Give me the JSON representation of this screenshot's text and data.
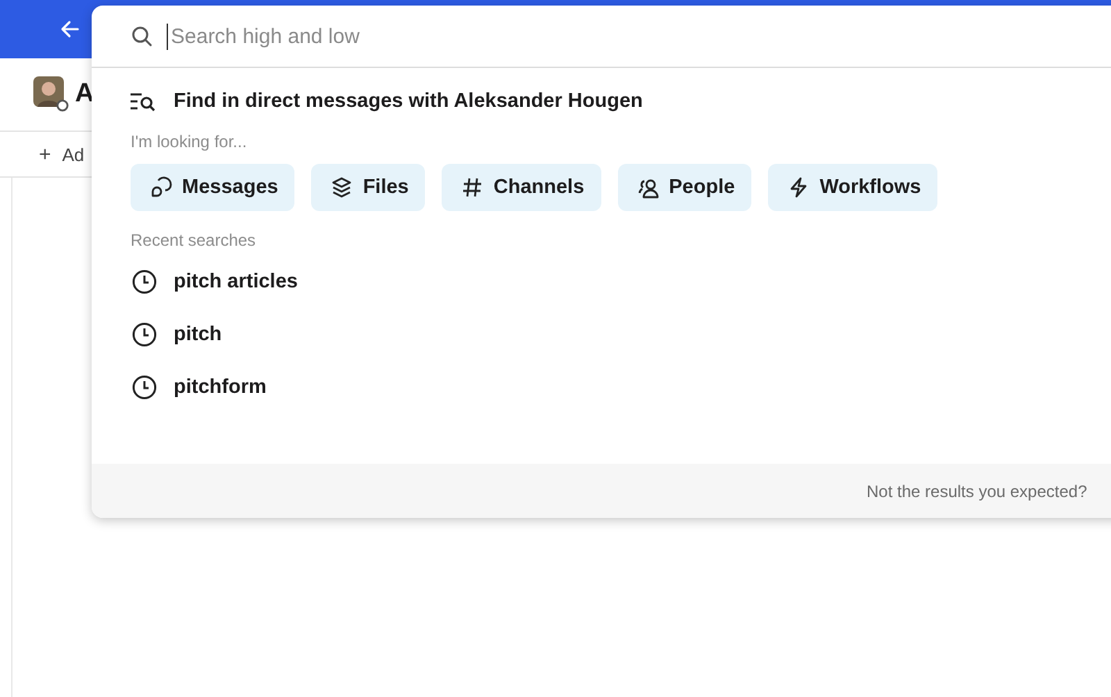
{
  "header": {
    "name": "A"
  },
  "add_row": {
    "icon": "+",
    "label": "Ad"
  },
  "search": {
    "placeholder": "Search high and low"
  },
  "scope": {
    "label": "Find in direct messages with Aleksander Hougen"
  },
  "filters_heading": "I'm looking for...",
  "filters": [
    {
      "kind": "messages",
      "label": "Messages"
    },
    {
      "kind": "files",
      "label": "Files"
    },
    {
      "kind": "channels",
      "label": "Channels"
    },
    {
      "kind": "people",
      "label": "People"
    },
    {
      "kind": "workflows",
      "label": "Workflows"
    }
  ],
  "recent_heading": "Recent searches",
  "recent": [
    {
      "label": "pitch articles"
    },
    {
      "label": "pitch"
    },
    {
      "label": "pitchform"
    }
  ],
  "footer": {
    "text": "Not the results you expected?"
  }
}
